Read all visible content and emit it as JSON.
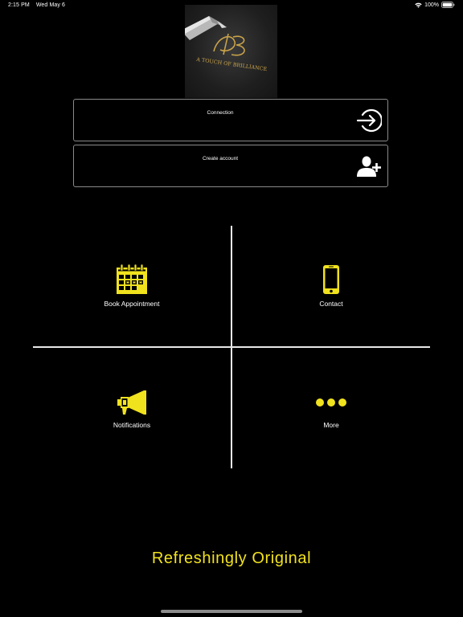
{
  "status_bar": {
    "time": "2:15 PM",
    "date": "Wed May 6",
    "battery": "100%"
  },
  "logo": {
    "monogram": "AB",
    "text": "A TOUCH OF BRILLIANCE"
  },
  "auth": {
    "connection_label": "Connection",
    "create_account_label": "Create account"
  },
  "menu": {
    "book_label": "Book Appointment",
    "contact_label": "Contact",
    "notifications_label": "Notifications",
    "more_label": "More"
  },
  "tagline": "Refreshingly Original",
  "icons": {
    "connection": "login-arrow-icon",
    "create_account": "add-user-icon",
    "book": "calendar-icon",
    "contact": "smartphone-icon",
    "notifications": "megaphone-icon",
    "more": "more-dots-icon"
  },
  "colors": {
    "background": "#000000",
    "accent_yellow": "#f1e21e",
    "gold": "#c9a34a",
    "divider": "#e8e8e8"
  }
}
